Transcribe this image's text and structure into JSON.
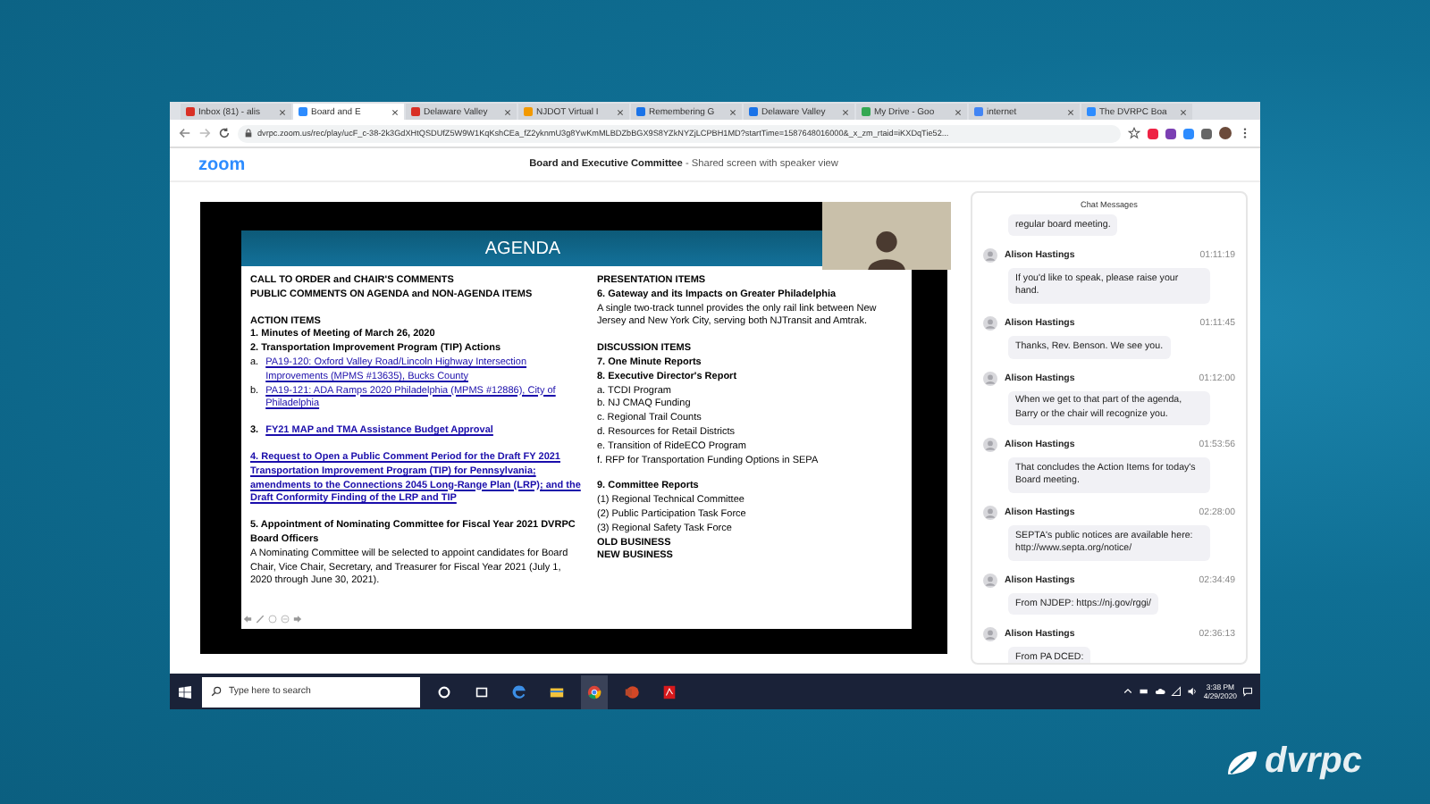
{
  "browser": {
    "tabs": [
      {
        "label": "Inbox (81) - alis",
        "selected": false,
        "color": "#d93025"
      },
      {
        "label": "Board and E",
        "selected": true,
        "color": "#2d8cff"
      },
      {
        "label": "Delaware Valley",
        "selected": false,
        "color": "#d93025"
      },
      {
        "label": "NJDOT Virtual I",
        "selected": false,
        "color": "#f29900"
      },
      {
        "label": "Remembering G",
        "selected": false,
        "color": "#1a73e8"
      },
      {
        "label": "Delaware Valley",
        "selected": false,
        "color": "#1a73e8"
      },
      {
        "label": "My Drive - Goo",
        "selected": false,
        "color": "#34a853"
      },
      {
        "label": "internet",
        "selected": false,
        "color": "#4285f4"
      },
      {
        "label": "The DVRPC Boa",
        "selected": false,
        "color": "#2d8cff"
      }
    ],
    "url": "dvrpc.zoom.us/rec/play/ucF_c-38-2k3GdXHtQSDUfZ5W9W1KqKshCEa_fZ2yknmU3g8YwKmMLBDZbBGX9S8YZkNYZjLCPBH1MD?startTime=1587648016000&_x_zm_rtaid=iKXDqTie52..."
  },
  "zoom_header": {
    "logo": "zoom",
    "title": "Board and Executive Committee",
    "subtitle": "- Shared screen with speaker view"
  },
  "slide": {
    "heading": "AGENDA",
    "left_column": [
      {
        "kind": "bold",
        "text": "CALL TO ORDER and CHAIR'S COMMENTS"
      },
      {
        "kind": "bold",
        "text": "PUBLIC COMMENTS ON AGENDA and NON-AGENDA ITEMS"
      },
      {
        "kind": "gap"
      },
      {
        "kind": "bold",
        "text": "ACTION ITEMS"
      },
      {
        "kind": "bold",
        "text": "1.  Minutes of Meeting of March 26, 2020"
      },
      {
        "kind": "bold",
        "text": "2. Transportation Improvement Program (TIP) Actions"
      },
      {
        "kind": "link",
        "prefix": "a.",
        "text": "PA19-120: Oxford Valley Road/Lincoln Highway Intersection Improvements (MPMS #13635), Bucks County",
        "strong": false
      },
      {
        "kind": "link",
        "prefix": "b.",
        "text": "PA19-121: ADA Ramps 2020 Philadelphia (MPMS #12886), City of Philadelphia",
        "strong": false
      },
      {
        "kind": "gap"
      },
      {
        "kind": "link",
        "prefix": "3.",
        "text": "FY21 MAP and TMA Assistance Budget Approval",
        "strong": true
      },
      {
        "kind": "gap"
      },
      {
        "kind": "link",
        "text": "4.  Request to Open a Public Comment Period for the Draft FY 2021 Transportation Improvement Program (TIP) for Pennsylvania; amendments to the Connections 2045 Long-Range Plan (LRP); and the Draft Conformity Finding of the LRP and TIP",
        "strong": true
      },
      {
        "kind": "gap"
      },
      {
        "kind": "bold",
        "text": "5.   Appointment of Nominating Committee for Fiscal Year 2021 DVRPC Board Officers"
      },
      {
        "kind": "text",
        "text": "A Nominating Committee will be selected to appoint candidates for Board Chair, Vice Chair, Secretary, and Treasurer for Fiscal Year 2021 (July 1, 2020 through June 30, 2021)."
      }
    ],
    "right_column": [
      {
        "kind": "bold",
        "text": "PRESENTATION ITEMS"
      },
      {
        "kind": "bold",
        "text": "6.   Gateway and its Impacts on Greater Philadelphia"
      },
      {
        "kind": "text",
        "text": "A single two-track tunnel provides the only rail link between New Jersey and New York City, serving both NJTransit and Amtrak."
      },
      {
        "kind": "gap"
      },
      {
        "kind": "bold",
        "text": "DISCUSSION ITEMS"
      },
      {
        "kind": "bold",
        "text": "7.   One Minute Reports"
      },
      {
        "kind": "bold",
        "text": "8.   Executive Director's Report"
      },
      {
        "kind": "text",
        "text": "a. TCDI Program"
      },
      {
        "kind": "text",
        "text": "b. NJ CMAQ Funding"
      },
      {
        "kind": "text",
        "text": "c. Regional Trail Counts"
      },
      {
        "kind": "text",
        "text": "d. Resources for Retail Districts"
      },
      {
        "kind": "text",
        "text": "e. Transition of RideECO Program"
      },
      {
        "kind": "text",
        "text": "f.  RFP for Transportation Funding Options in SEPA"
      },
      {
        "kind": "gap"
      },
      {
        "kind": "bold",
        "text": "9.   Committee Reports"
      },
      {
        "kind": "text",
        "text": "(1) Regional Technical Committee"
      },
      {
        "kind": "text",
        "text": "(2) Public Participation Task Force"
      },
      {
        "kind": "text",
        "text": "(3) Regional Safety Task Force"
      },
      {
        "kind": "bold",
        "text": "OLD BUSINESS"
      },
      {
        "kind": "bold",
        "text": "NEW BUSINESS"
      }
    ]
  },
  "chat": {
    "title": "Chat Messages",
    "first_message_tail": "regular board meeting.",
    "messages": [
      {
        "name": "Alison Hastings",
        "time": "01:11:19",
        "text": "If you'd like to speak, please raise your hand."
      },
      {
        "name": "Alison Hastings",
        "time": "01:11:45",
        "text": "Thanks, Rev. Benson. We see you."
      },
      {
        "name": "Alison Hastings",
        "time": "01:12:00",
        "text": "When we get to that part of the agenda, Barry or the chair will recognize you."
      },
      {
        "name": "Alison Hastings",
        "time": "01:53:56",
        "text": "That concludes the Action Items for today's Board meeting."
      },
      {
        "name": "Alison Hastings",
        "time": "02:28:00",
        "text": "SEPTA's public notices are available here: http://www.septa.org/notice/"
      },
      {
        "name": "Alison Hastings",
        "time": "02:34:49",
        "text": "From NJDEP: https://nj.gov/rggi/"
      },
      {
        "name": "Alison Hastings",
        "time": "02:36:13",
        "text": "From PA DCED:"
      }
    ]
  },
  "taskbar": {
    "search_placeholder": "Type here to search",
    "time": "3:38 PM",
    "date": "4/29/2020"
  },
  "brand": {
    "logo": "dvrpc"
  }
}
